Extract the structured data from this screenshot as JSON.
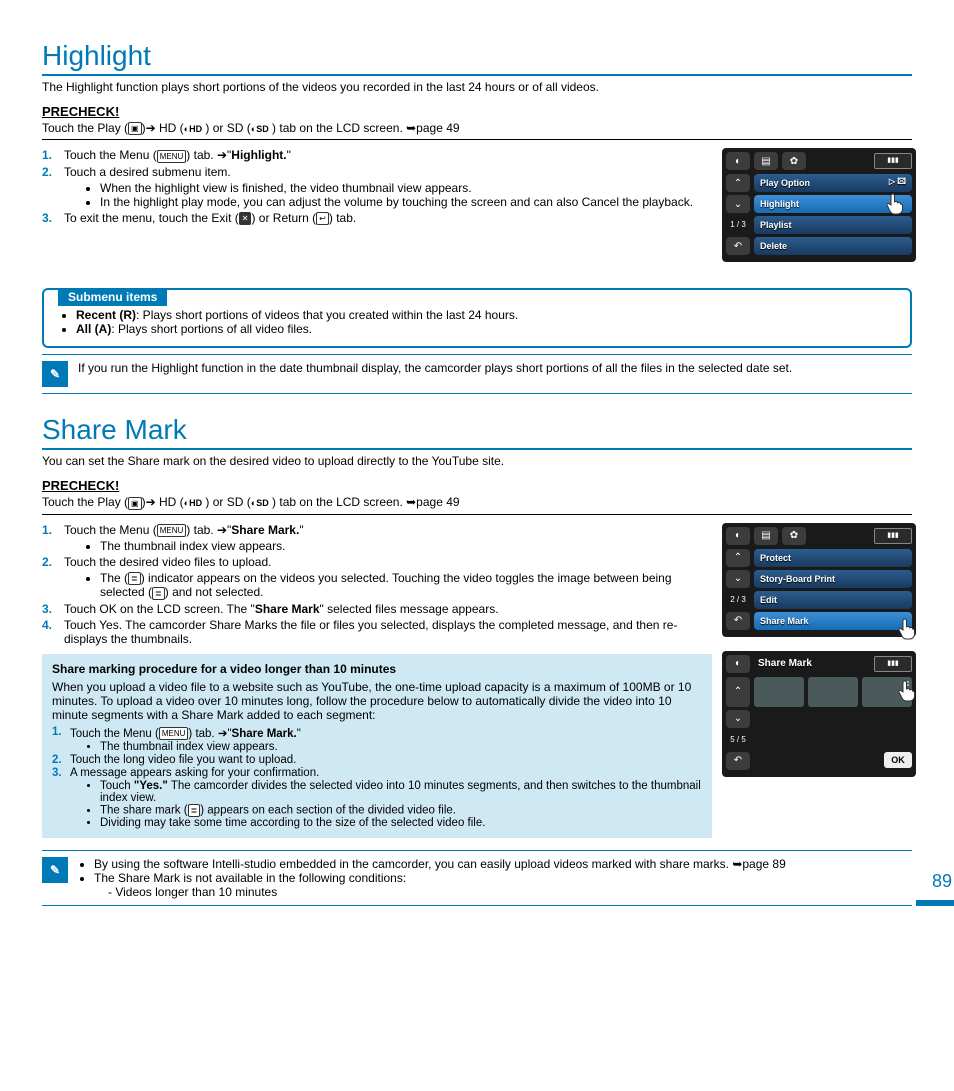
{
  "page_number": "89",
  "icons": {
    "menu": "MENU",
    "play": "▣",
    "hd": "HD",
    "sd": "SD",
    "exit": "✕",
    "return": "↩",
    "recent": "R",
    "all": "A",
    "file": "≣",
    "ref": "➥"
  },
  "section1": {
    "title": "Highlight",
    "intro": "The Highlight function plays short portions of the videos you recorded in the last 24 hours or of all videos.",
    "precheck_h": "PRECHECK!",
    "precheck_t1": "Touch the Play (",
    "precheck_t2": ")➔ HD (",
    "precheck_t3": " ) or SD (",
    "precheck_t4": " ) tab on the LCD screen. ➥page 49",
    "steps": {
      "s1a": "Touch the Menu (",
      "s1b": ") tab. ➔\"",
      "s1c": "Highlight.",
      "s1d": "\"",
      "s2": "Touch a desired submenu item.",
      "s2b1": "When the highlight view is finished, the video thumbnail view appears.",
      "s2b2": "In the highlight play mode, you can adjust the volume by touching the screen and can also Cancel the playback.",
      "s3a": "To exit the menu, touch the Exit (",
      "s3b": ") or Return (",
      "s3c": ") tab."
    },
    "submenu_h": "Submenu items",
    "sub_recent_a": "Recent (",
    "sub_recent_b": ")",
    "sub_recent_t": ": Plays short portions of videos that you created within the last 24 hours.",
    "sub_all_a": "All (",
    "sub_all_b": ")",
    "sub_all_t": ": Plays short portions of all video files.",
    "note": "If you run the Highlight function in the date thumbnail display, the camcorder plays short portions of all the files in the selected date set.",
    "lcd": {
      "count": "1 / 3",
      "items": [
        "Play Option",
        "Highlight",
        "Playlist",
        "Delete"
      ],
      "play_r": "▷ 🖾"
    }
  },
  "section2": {
    "title": "Share Mark",
    "intro": "You can set the Share mark on the desired video to upload directly to the YouTube site.",
    "precheck_h": "PRECHECK!",
    "precheck_t1": "Touch the Play (",
    "precheck_t2": ")➔ HD (",
    "precheck_t3": " ) or SD (",
    "precheck_t4": " ) tab on the LCD screen. ➥page 49",
    "steps": {
      "s1a": "Touch the Menu (",
      "s1b": ") tab. ➔\"",
      "s1c": "Share Mark.",
      "s1d": "\"",
      "s1b1": "The thumbnail index view appears.",
      "s2": "Touch the desired video files to upload.",
      "s2b1a": "The (",
      "s2b1b": ") indicator appears on the videos you selected. Touching the video toggles the image between being selected (",
      "s2b1c": ") and not selected.",
      "s3a": "Touch OK on the LCD screen. The \"",
      "s3b": "Share Mark",
      "s3c": "\" selected files message appears.",
      "s4": "Touch Yes. The camcorder Share Marks the file or files you selected, displays the completed message, and then re-displays the thumbnails."
    },
    "bluebox": {
      "h": "Share marking procedure for a video longer than 10 minutes",
      "p": "When you upload a video file to a website such as YouTube, the one-time upload capacity is a maximum of 100MB or 10 minutes. To upload a video over 10 minutes long, follow the procedure below to automatically divide the video into 10 minute segments with a Share Mark added to each segment:",
      "s1a": "Touch the Menu (",
      "s1b": ") tab. ➔\"",
      "s1c": "Share Mark.",
      "s1d": "\"",
      "s1b1": "The thumbnail index view appears.",
      "s2": "Touch the long video file you want to upload.",
      "s3": "A message appears asking for your confirmation.",
      "s3b1a": "Touch ",
      "s3b1b": "\"Yes.\"",
      "s3b1c": " The camcorder divides the selected video into 10 minutes segments, and then switches to the thumbnail index view.",
      "s3b2a": "The share mark (",
      "s3b2b": ") appears on each section of the divided video file.",
      "s3b3": "Dividing may take some time according to the size of the selected video file."
    },
    "note1": "By using the software Intelli-studio embedded in the camcorder, you can easily upload videos marked with share marks. ➥page 89",
    "note2": "The Share Mark is not available in the following conditions:",
    "note2a": "-   Videos longer than 10 minutes",
    "lcd1": {
      "count": "2 / 3",
      "items": [
        "Protect",
        "Story-Board Print",
        "Edit",
        "Share Mark"
      ]
    },
    "lcd2": {
      "title": "Share Mark",
      "count": "5 / 5",
      "ok": "OK"
    }
  }
}
